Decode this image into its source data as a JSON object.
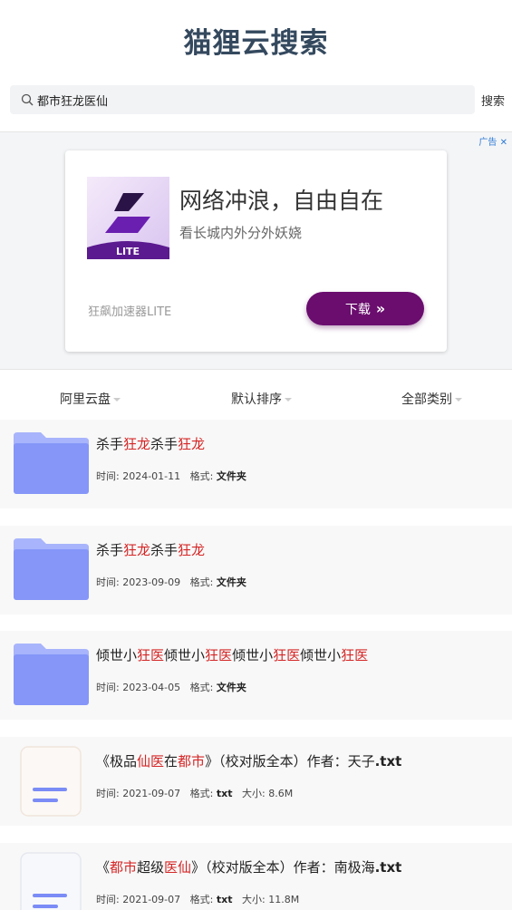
{
  "app": {
    "title": "猫狸云搜索"
  },
  "search": {
    "query": "都市狂龙医仙",
    "button_label": "搜索"
  },
  "ad": {
    "tag": "广告",
    "close": "✕",
    "logo_text": "LITE",
    "headline": "网络冲浪，自由自在",
    "subline": "看长城内外分外妖娆",
    "brand": "狂飙加速器LITE",
    "download_label": "下载",
    "download_arrows": "»"
  },
  "filters": [
    {
      "label": "阿里云盘"
    },
    {
      "label": "默认排序"
    },
    {
      "label": "全部类别"
    }
  ],
  "results": [
    {
      "title_parts": [
        "杀手",
        "狂龙",
        "杀手",
        "狂龙"
      ],
      "time_label": "时间:",
      "time": "2024-01-11",
      "format_label": "格式:",
      "format": "文件夹"
    },
    {
      "title_parts": [
        "杀手",
        "狂龙",
        "杀手",
        "狂龙"
      ],
      "time_label": "时间:",
      "time": "2023-09-09",
      "format_label": "格式:",
      "format": "文件夹"
    },
    {
      "title_parts": [
        "倾世小",
        "狂医",
        "倾世小",
        "狂医",
        "倾世小",
        "狂医",
        "倾世小",
        "狂医"
      ],
      "time_label": "时间:",
      "time": "2023-04-05",
      "format_label": "格式:",
      "format": "文件夹"
    },
    {
      "title_parts": [
        "《极品",
        "仙医",
        "在",
        "都市",
        "》（校对版全本）作者：天子",
        ".txt"
      ],
      "time_label": "时间:",
      "time": "2021-09-07",
      "format_label": "格式:",
      "format": "txt",
      "size_label": "大小:",
      "size": "8.6M"
    },
    {
      "title_parts": [
        "《",
        "都市",
        "超级",
        "医仙",
        "》（校对版全本）作者：南极海",
        ".txt"
      ],
      "time_label": "时间:",
      "time": "2021-09-07",
      "format_label": "格式:",
      "format": "txt",
      "size_label": "大小:",
      "size": "11.8M"
    }
  ],
  "colors": {
    "highlight": "#d42626",
    "title": "#34495e",
    "ad_button": "#6a0d6e",
    "ad_tag": "#2e7bd6"
  }
}
